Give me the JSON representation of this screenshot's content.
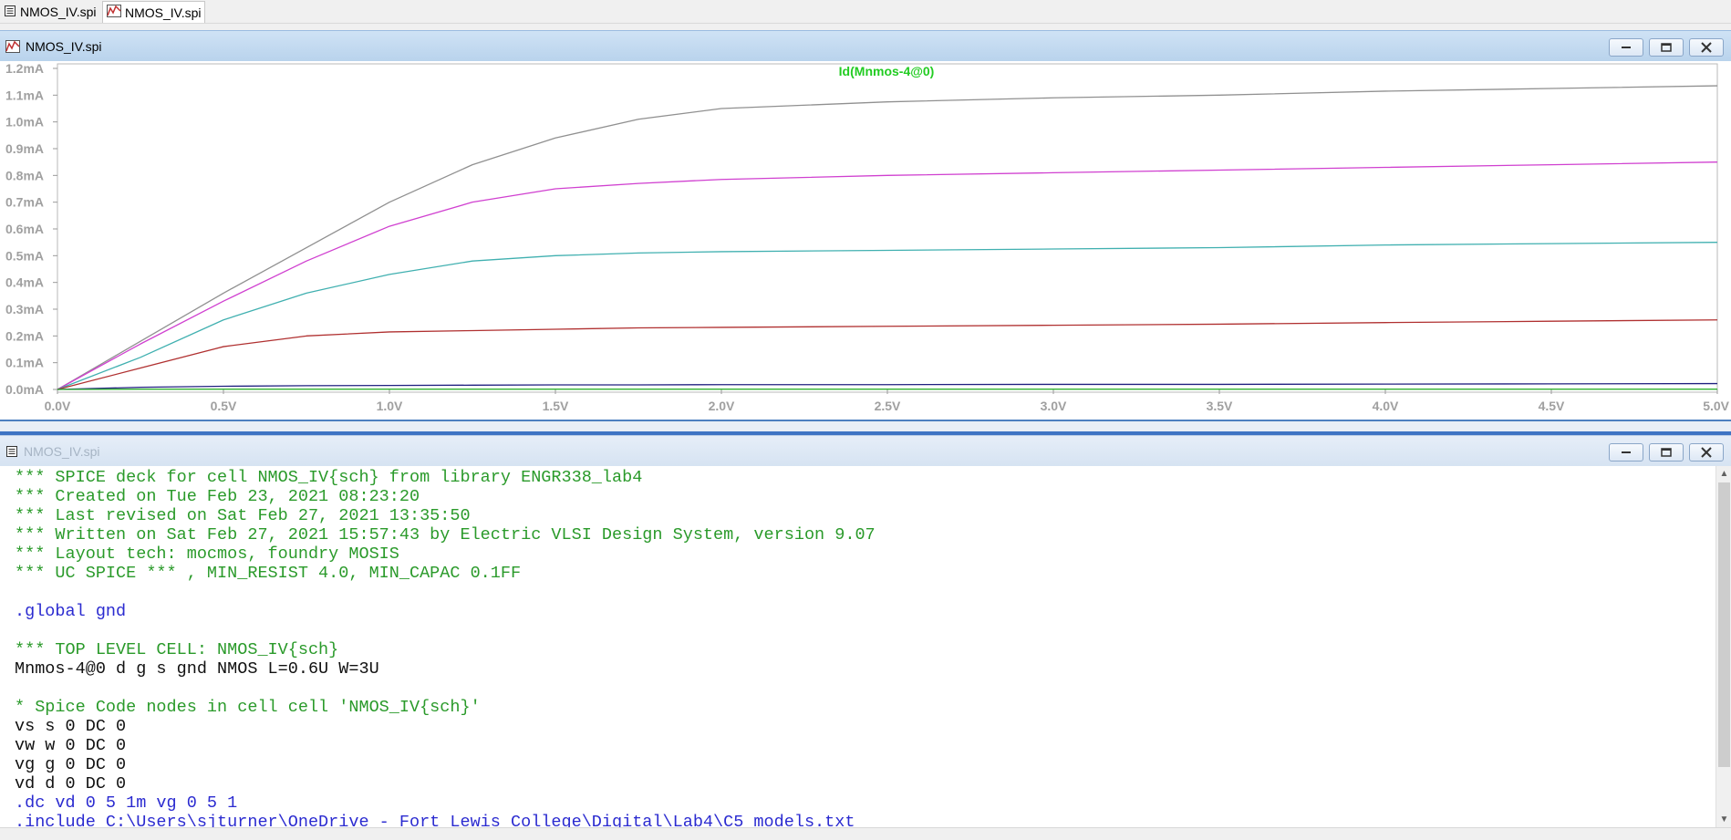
{
  "tabs": [
    {
      "label": "NMOS_IV.spi",
      "icon": "text-document-icon",
      "active": false
    },
    {
      "label": "NMOS_IV.spi",
      "icon": "waveform-icon",
      "active": true
    }
  ],
  "plot_window": {
    "title": "NMOS_IV.spi",
    "buttons": [
      "minimize-icon",
      "restore-icon",
      "close-icon"
    ]
  },
  "text_window": {
    "title": "NMOS_IV.spi",
    "buttons": [
      "minimize-icon",
      "restore-icon",
      "close-icon"
    ]
  },
  "colors": {
    "trace_title": "#22cc22",
    "axis_label": "#a0a0a0",
    "series": [
      "#909090",
      "#d040d0",
      "#40b0b0",
      "#b03030",
      "#202080",
      "#30b030"
    ]
  },
  "chart_data": {
    "type": "line",
    "title": "Id(Mnmos-4@0)",
    "xlabel": "",
    "ylabel": "",
    "xlim": [
      0,
      5
    ],
    "ylim": [
      0,
      1.2
    ],
    "x_ticks": [
      "0.0V",
      "0.5V",
      "1.0V",
      "1.5V",
      "2.0V",
      "2.5V",
      "3.0V",
      "3.5V",
      "4.0V",
      "4.5V",
      "5.0V"
    ],
    "y_ticks": [
      "0.0mA",
      "0.1mA",
      "0.2mA",
      "0.3mA",
      "0.4mA",
      "0.5mA",
      "0.6mA",
      "0.7mA",
      "0.8mA",
      "0.9mA",
      "1.0mA",
      "1.1mA",
      "1.2mA"
    ],
    "x": [
      0,
      0.25,
      0.5,
      0.75,
      1.0,
      1.25,
      1.5,
      1.75,
      2.0,
      2.5,
      3.0,
      3.5,
      4.0,
      4.5,
      5.0
    ],
    "series": [
      {
        "color": "#909090",
        "values": [
          0,
          0.18,
          0.36,
          0.53,
          0.7,
          0.84,
          0.94,
          1.01,
          1.05,
          1.075,
          1.09,
          1.1,
          1.115,
          1.125,
          1.135
        ]
      },
      {
        "color": "#d040d0",
        "values": [
          0,
          0.17,
          0.33,
          0.48,
          0.61,
          0.7,
          0.75,
          0.77,
          0.785,
          0.8,
          0.81,
          0.82,
          0.83,
          0.84,
          0.85
        ]
      },
      {
        "color": "#40b0b0",
        "values": [
          0,
          0.12,
          0.26,
          0.36,
          0.43,
          0.48,
          0.5,
          0.51,
          0.515,
          0.52,
          0.525,
          0.53,
          0.54,
          0.545,
          0.55
        ]
      },
      {
        "color": "#b03030",
        "values": [
          0,
          0.08,
          0.16,
          0.2,
          0.215,
          0.22,
          0.225,
          0.23,
          0.232,
          0.236,
          0.24,
          0.244,
          0.25,
          0.255,
          0.26
        ]
      },
      {
        "color": "#202080",
        "values": [
          0,
          0.008,
          0.012,
          0.014,
          0.015,
          0.016,
          0.017,
          0.017,
          0.018,
          0.018,
          0.019,
          0.019,
          0.02,
          0.021,
          0.022
        ]
      },
      {
        "color": "#30b030",
        "values": [
          0,
          0.001,
          0.001,
          0.001,
          0.001,
          0.001,
          0.001,
          0.001,
          0.001,
          0.001,
          0.001,
          0.001,
          0.001,
          0.001,
          0.001
        ]
      }
    ]
  },
  "spice_lines": [
    {
      "text": "*** SPICE deck for cell NMOS_IV{sch} from library ENGR338_lab4",
      "color": "green"
    },
    {
      "text": "*** Created on Tue Feb 23, 2021 08:23:20",
      "color": "green"
    },
    {
      "text": "*** Last revised on Sat Feb 27, 2021 13:35:50",
      "color": "green"
    },
    {
      "text": "*** Written on Sat Feb 27, 2021 15:57:43 by Electric VLSI Design System, version 9.07",
      "color": "green"
    },
    {
      "text": "*** Layout tech: mocmos, foundry MOSIS",
      "color": "green"
    },
    {
      "text": "*** UC SPICE *** , MIN_RESIST 4.0, MIN_CAPAC 0.1FF",
      "color": "green"
    },
    {
      "text": "",
      "color": "black"
    },
    {
      "text": ".global gnd",
      "color": "blue"
    },
    {
      "text": "",
      "color": "black"
    },
    {
      "text": "*** TOP LEVEL CELL: NMOS_IV{sch}",
      "color": "green"
    },
    {
      "text": "Mnmos-4@0 d g s gnd NMOS L=0.6U W=3U",
      "color": "black"
    },
    {
      "text": "",
      "color": "black"
    },
    {
      "text": "* Spice Code nodes in cell cell 'NMOS_IV{sch}'",
      "color": "green"
    },
    {
      "text": "vs s 0 DC 0",
      "color": "black"
    },
    {
      "text": "vw w 0 DC 0",
      "color": "black"
    },
    {
      "text": "vg g 0 DC 0",
      "color": "black"
    },
    {
      "text": "vd d 0 DC 0",
      "color": "black"
    },
    {
      "text": ".dc vd 0 5 1m vg 0 5 1",
      "color": "blue"
    },
    {
      "text": ".include C:\\Users\\sjturner\\OneDrive - Fort Lewis College\\Digital\\Lab4\\C5_models.txt",
      "color": "blue"
    }
  ]
}
